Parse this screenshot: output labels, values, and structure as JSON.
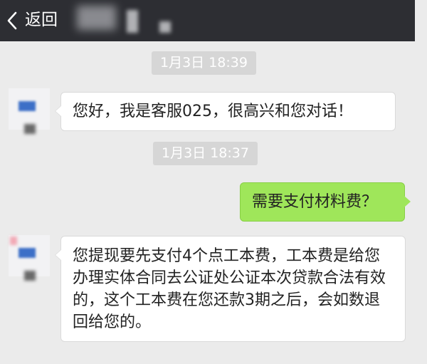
{
  "header": {
    "back_label": "返回",
    "title": ""
  },
  "messages": [
    {
      "type": "timestamp",
      "text": "1月3日 18:39"
    },
    {
      "type": "incoming",
      "text": "您好，我是客服025，很高兴和您对话！"
    },
    {
      "type": "timestamp",
      "text": "1月3日 18:37"
    },
    {
      "type": "outgoing",
      "text": "需要支付材料费？"
    },
    {
      "type": "incoming",
      "text": "您提现要先支付4个点工本费，工本费是给您办理实体合同去公证处公证本次贷款合法有效的，这个工本费在您还款3期之后，会如数退回给您的。"
    }
  ],
  "colors": {
    "header_bg": "#2d2e33",
    "chat_bg": "#ebebeb",
    "outgoing_bubble": "#9fe65a",
    "incoming_bubble": "#ffffff",
    "timestamp_bg": "#d6d6d6"
  }
}
